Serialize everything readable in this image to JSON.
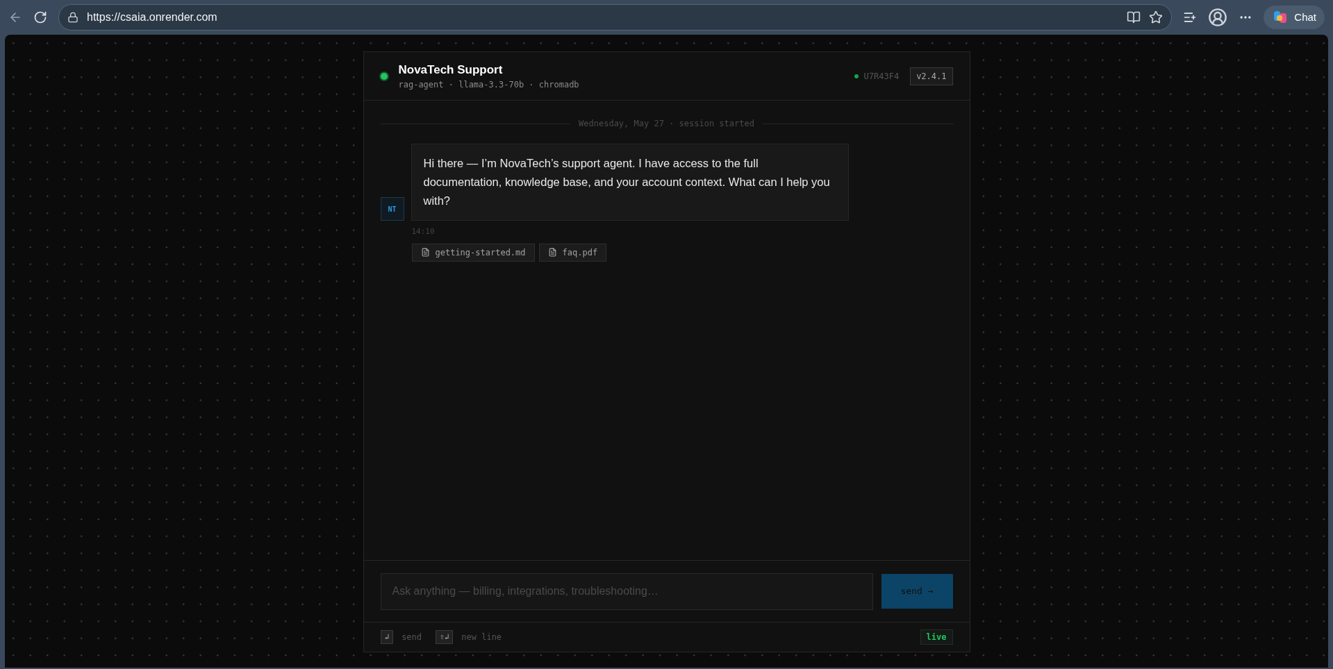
{
  "browser": {
    "url": "https://csaia.onrender.com",
    "chat_button": "Chat"
  },
  "chat": {
    "title": "NovaTech Support",
    "online": true,
    "subtitle": "rag-agent · llama-3.3-70b · chromadb",
    "session_id": "U7R43F4",
    "version": "v2.4.1",
    "divider": "Wednesday, May 27 · session started",
    "messages": [
      {
        "avatar": "NT",
        "text": "Hi there — I’m NovaTech’s support agent. I have access to the full documentation, knowledge base, and your account context. What can I help you with?",
        "time": "14:10",
        "attachments": [
          "getting-started.md",
          "faq.pdf"
        ]
      }
    ],
    "input": {
      "placeholder": "Ask anything — billing, integrations, troubleshooting…"
    },
    "send_button": "send →",
    "shortcuts": [
      {
        "key": "↲",
        "label": "send"
      },
      {
        "key": "⇧↲",
        "label": "new line"
      }
    ],
    "status": "live"
  }
}
